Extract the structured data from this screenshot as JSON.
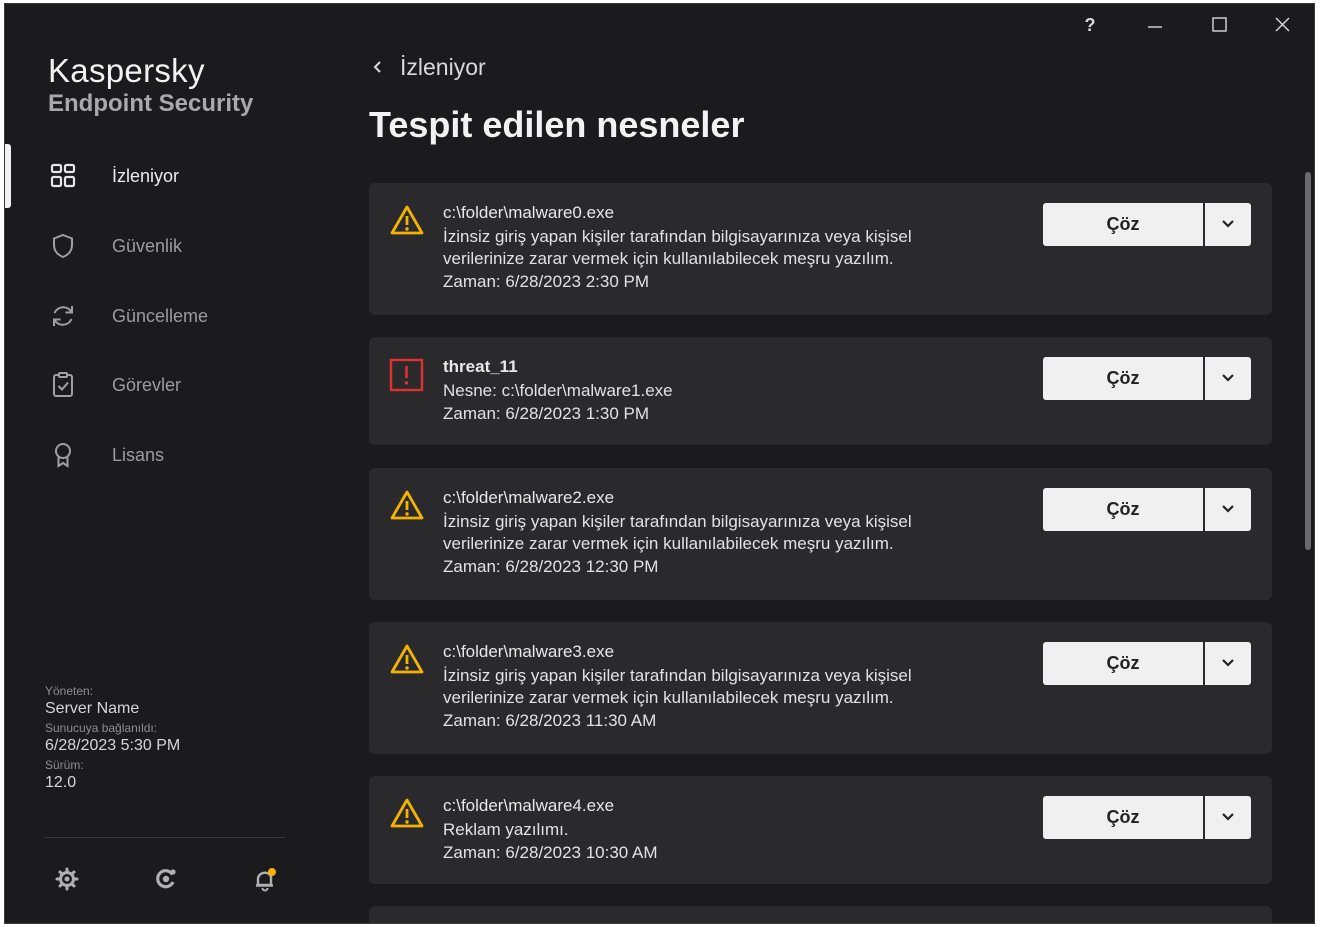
{
  "app": {
    "brand_line1": "Kaspersky",
    "brand_line2": "Endpoint Security"
  },
  "titlebar": {
    "help_label": "?"
  },
  "sidebar": {
    "items": [
      {
        "label": "İzleniyor",
        "icon": "grid-icon",
        "active": true
      },
      {
        "label": "Güvenlik",
        "icon": "shield-icon",
        "active": false
      },
      {
        "label": "Güncelleme",
        "icon": "refresh-icon",
        "active": false
      },
      {
        "label": "Görevler",
        "icon": "clipboard-check-icon",
        "active": false
      },
      {
        "label": "Lisans",
        "icon": "award-icon",
        "active": false
      }
    ],
    "managed_by_label": "Yöneten:",
    "server_name": "Server Name",
    "connected_label": "Sunucuya bağlanıldı:",
    "connected_time": "6/28/2023 5:30 PM",
    "version_label": "Sürüm:",
    "version": "12.0",
    "footer_icons": [
      "gear-icon",
      "support-icon",
      "notification-bell-icon"
    ]
  },
  "main": {
    "back_label": "İzleniyor",
    "title": "Tespit edilen nesneler",
    "resolve_label": "Çöz",
    "cards": [
      {
        "severity": "warning",
        "title": "c:\\folder\\malware0.exe",
        "desc1": "İzinsiz giriş yapan kişiler tarafından bilgisayarınıza veya kişisel",
        "desc2": "verilerinize zarar vermek için kullanılabilecek meşru yazılım.",
        "time": "Zaman: 6/28/2023 2:30 PM"
      },
      {
        "severity": "critical",
        "title": "threat_11",
        "desc1": "Nesne: c:\\folder\\malware1.exe",
        "desc2": "",
        "time": "Zaman: 6/28/2023 1:30 PM"
      },
      {
        "severity": "warning",
        "title": "c:\\folder\\malware2.exe",
        "desc1": "İzinsiz giriş yapan kişiler tarafından bilgisayarınıza veya kişisel",
        "desc2": "verilerinize zarar vermek için kullanılabilecek meşru yazılım.",
        "time": "Zaman: 6/28/2023 12:30 PM"
      },
      {
        "severity": "warning",
        "title": "c:\\folder\\malware3.exe",
        "desc1": "İzinsiz giriş yapan kişiler tarafından bilgisayarınıza veya kişisel",
        "desc2": "verilerinize zarar vermek için kullanılabilecek meşru yazılım.",
        "time": "Zaman: 6/28/2023 11:30 AM"
      },
      {
        "severity": "warning",
        "title": "c:\\folder\\malware4.exe",
        "desc1": "Reklam yazılımı.",
        "desc2": "",
        "time": "Zaman: 6/28/2023 10:30 AM"
      }
    ]
  },
  "colors": {
    "warning": "#f5b301",
    "critical": "#e0312e",
    "background": "#1b1b1d",
    "card": "#2a2a2d"
  }
}
